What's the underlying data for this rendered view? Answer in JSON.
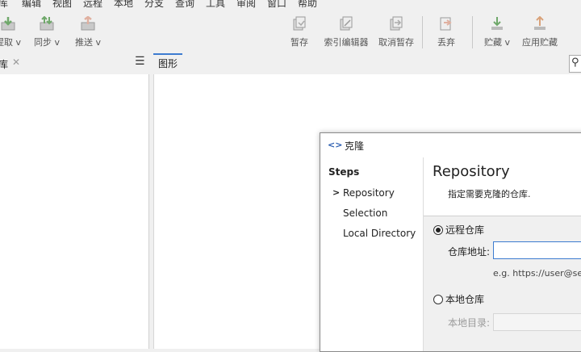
{
  "menu": [
    "库",
    "编辑",
    "视图",
    "远程",
    "本地",
    "分支",
    "查询",
    "工具",
    "审阅",
    "窗口",
    "帮助"
  ],
  "toolbar": {
    "fetch": "提取 v",
    "sync": "同步 v",
    "push": "推送 v",
    "stash": "暂存",
    "index_editor": "索引编辑器",
    "unstash": "取消暂存",
    "discard": "丢弃",
    "shelve": "贮藏 v",
    "apply_shelve": "应用贮藏"
  },
  "left_pane": {
    "title": "库",
    "close": "✕",
    "menu_icon": "☰"
  },
  "graph_tab": {
    "label": "图形"
  },
  "search_icon_glyph": "⚲",
  "colors": {
    "accent": "#3d7bd0",
    "icon_green": "#6fa86a",
    "icon_gray": "#9a9a9a"
  },
  "dialog": {
    "title_icon": "<>",
    "title": "克隆",
    "steps_header": "Steps",
    "current_marker": ">",
    "steps": [
      "Repository",
      "Selection",
      "Local Directory"
    ],
    "heading": "Repository",
    "subtitle": "指定需要克隆的仓库.",
    "remote_label": "远程仓库",
    "repo_url_label": "仓库地址:",
    "repo_url_value": "",
    "example": "e.g. https://user@ser",
    "local_label": "本地仓库",
    "local_dir_label": "本地目录:",
    "local_dir_value": ""
  }
}
